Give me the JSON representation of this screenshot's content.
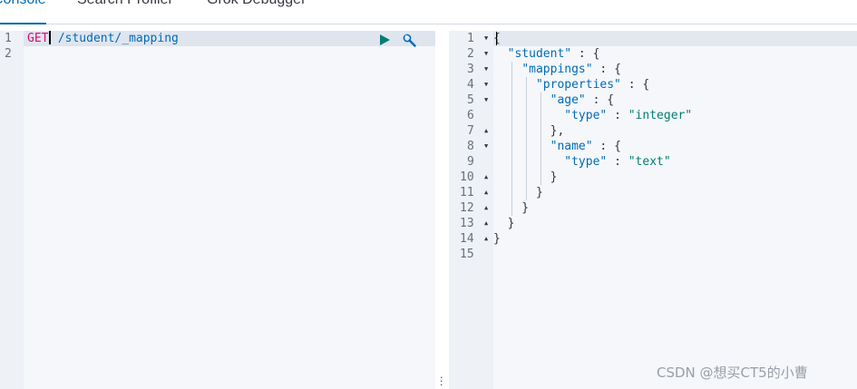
{
  "tabs": [
    "Console",
    "Search Profiler",
    "Grok Debugger"
  ],
  "request_editor": {
    "line_numbers": [
      "1",
      "2"
    ],
    "method": "GET",
    "url": "/student/_mapping",
    "run_icon": "play-icon",
    "settings_icon": "wrench-icon"
  },
  "response_editor": {
    "line_numbers": [
      "1",
      "2",
      "3",
      "4",
      "5",
      "6",
      "7",
      "8",
      "9",
      "10",
      "11",
      "12",
      "13",
      "14",
      "15"
    ],
    "keys": {
      "student": "\"student\"",
      "mappings": "\"mappings\"",
      "properties": "\"properties\"",
      "age": "\"age\"",
      "age_type": "\"type\"",
      "age_type_value": "\"integer\"",
      "name": "\"name\"",
      "name_type": "\"type\"",
      "name_type_value": "\"text\""
    }
  },
  "watermark": "CSDN @想买CT5的小曹",
  "colors": {
    "accent": "#006bb4",
    "method": "#dd0a73",
    "string_value": "#017d73",
    "run_button": "#017d73"
  }
}
